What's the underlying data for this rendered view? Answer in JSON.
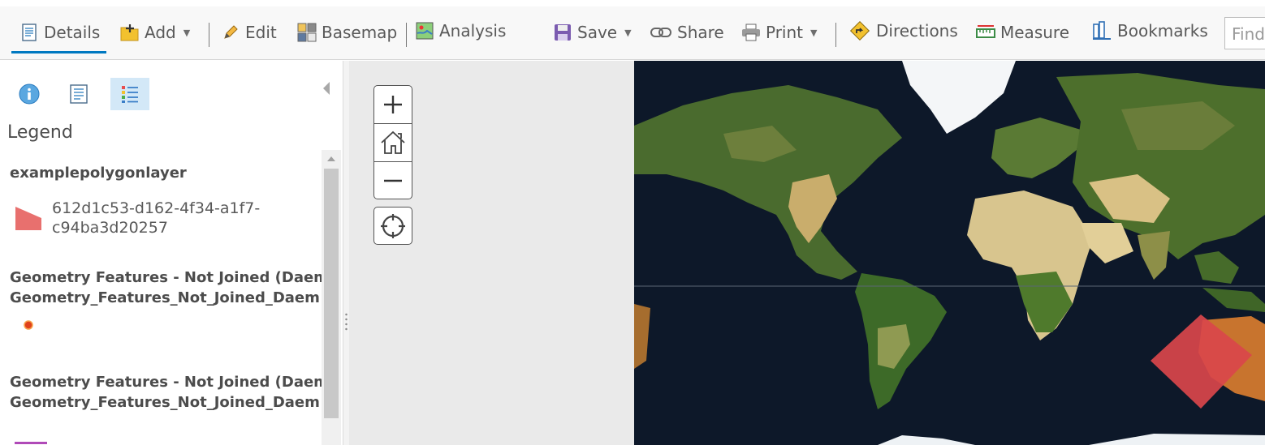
{
  "toolbar": {
    "details": "Details",
    "add": "Add",
    "edit": "Edit",
    "basemap": "Basemap",
    "analysis": "Analysis",
    "save": "Save",
    "share": "Share",
    "print": "Print",
    "directions": "Directions",
    "measure": "Measure",
    "bookmarks": "Bookmarks",
    "find_placeholder": "Find"
  },
  "panel": {
    "tabs": [
      "about-icon",
      "content-icon",
      "legend-icon"
    ],
    "active_tab": "legend",
    "legend_title": "Legend",
    "layers": [
      {
        "name": "examplepolygonlayer",
        "symbol": "polygon-swatch-icon",
        "symbol_color": "#e8706e",
        "label_line1": "612d1c53-d162-4f34-a1f7-",
        "label_line2": "c94ba3d20257"
      },
      {
        "name_line1": "Geometry Features - Not Joined (Daeme",
        "name_line2": "Geometry_Features_Not_Joined_Daem",
        "symbol": "point-marker-icon",
        "symbol_color": "#e0411c"
      },
      {
        "name_line1": "Geometry Features - Not Joined (Daeme",
        "name_line2": "Geometry_Features_Not_Joined_Daem",
        "symbol": "line-swatch-icon",
        "symbol_color": "#b04ab8"
      }
    ]
  },
  "map": {
    "controls": [
      "zoom-in-icon",
      "home-icon",
      "zoom-out-icon",
      "locate-icon"
    ],
    "basemap": "imagery",
    "feature_color": "#d9474b"
  },
  "colors": {
    "accent": "#0079c1",
    "active_tab_bg": "#d3e8f7"
  }
}
